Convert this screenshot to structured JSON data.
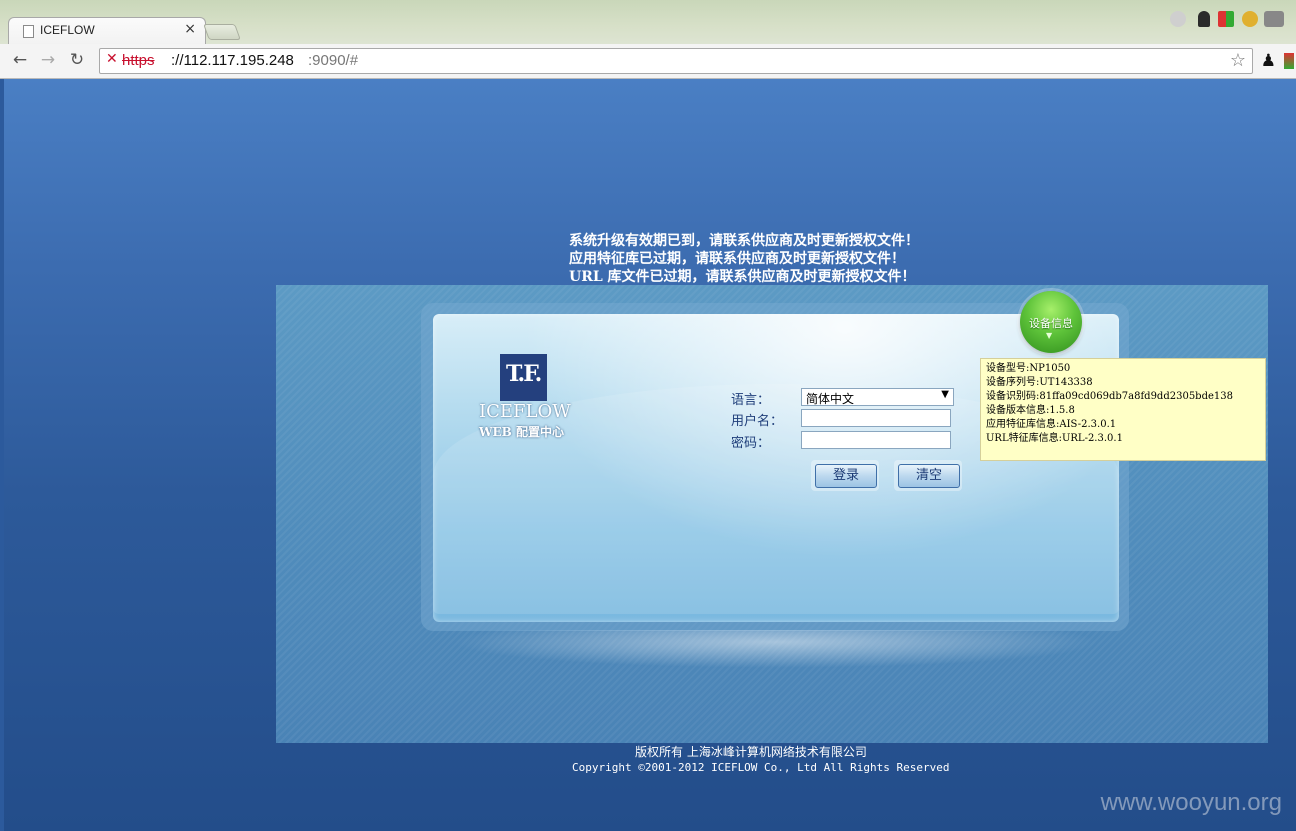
{
  "browser": {
    "tab_title": "ICEFLOW",
    "tab_close": "×",
    "url_scheme": "https",
    "url_host": "://112.117.195.248",
    "url_rest": ":9090/#"
  },
  "notices": [
    "系统升级有效期已到，请联系供应商及时更新授权文件！",
    "应用特征库已过期，请联系供应商及时更新授权文件！",
    "URL 库文件已过期，请联系供应商及时更新授权文件！"
  ],
  "logo": {
    "monogram": "T.F.",
    "wordmark": "ICEFLOW",
    "subtitle": "WEB 配置中心"
  },
  "form": {
    "language_label": "语言：",
    "language_value": "简体中文",
    "username_label": "用户名：",
    "password_label": "密码：",
    "login_button": "登录",
    "clear_button": "清空"
  },
  "device_button": "设备信息",
  "device_info": [
    "设备型号:NP1050",
    "设备序列号:UT143338",
    "设备识别码:81ffa09cd069db7a8fd9dd2305bde138",
    "设备版本信息:1.5.8",
    "应用特征库信息:AIS-2.3.0.1",
    "URL特征库信息:URL-2.3.0.1"
  ],
  "footer": {
    "copyright_cn": "版权所有 上海冰峰计算机网络技术有限公司",
    "copyright_en": "Copyright ©2001-2012 ICEFLOW Co., Ltd All Rights Reserved"
  },
  "watermark": "www.wooyun.org"
}
